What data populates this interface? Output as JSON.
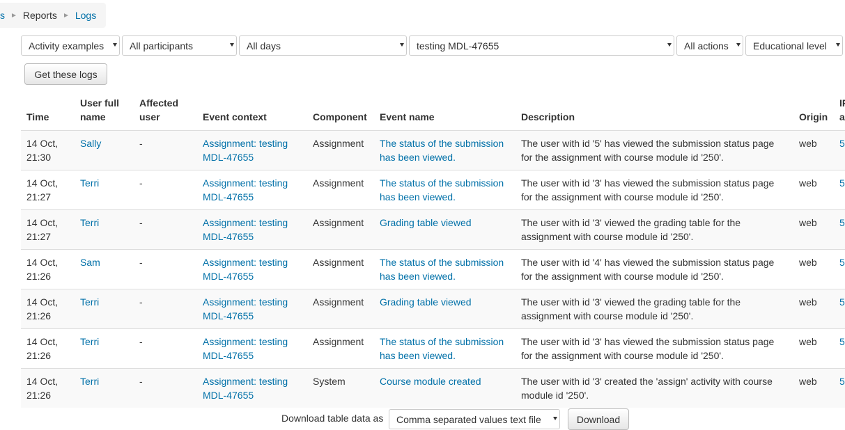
{
  "breadcrumb": {
    "prev": "s",
    "reports": "Reports",
    "current": "Logs"
  },
  "filters": {
    "course": "Activity examples",
    "participants": "All participants",
    "days": "All days",
    "activity": "testing MDL-47655",
    "actions": "All actions",
    "level": "Educational level"
  },
  "get_logs_label": "Get these logs",
  "table": {
    "headers": {
      "time": "Time",
      "user": "User full name",
      "affected": "Affected user",
      "context": "Event context",
      "component": "Component",
      "event": "Event name",
      "description": "Description",
      "origin": "Origin",
      "ip": "IP a"
    },
    "rows": [
      {
        "time": "14 Oct, 21:30",
        "user": "Sally",
        "affected": "-",
        "context": "Assignment: testing MDL-47655",
        "component": "Assignment",
        "event": "The status of the submission has been viewed.",
        "description": "The user with id '5' has viewed the submission status page for the assignment with course module id '250'.",
        "origin": "web",
        "ip": "5"
      },
      {
        "time": "14 Oct, 21:27",
        "user": "Terri",
        "affected": "-",
        "context": "Assignment: testing MDL-47655",
        "component": "Assignment",
        "event": "The status of the submission has been viewed.",
        "description": "The user with id '3' has viewed the submission status page for the assignment with course module id '250'.",
        "origin": "web",
        "ip": "5"
      },
      {
        "time": "14 Oct, 21:27",
        "user": "Terri",
        "affected": "-",
        "context": "Assignment: testing MDL-47655",
        "component": "Assignment",
        "event": "Grading table viewed",
        "description": "The user with id '3' viewed the grading table for the assignment with course module id '250'.",
        "origin": "web",
        "ip": "5"
      },
      {
        "time": "14 Oct, 21:26",
        "user": "Sam",
        "affected": "-",
        "context": "Assignment: testing MDL-47655",
        "component": "Assignment",
        "event": "The status of the submission has been viewed.",
        "description": "The user with id '4' has viewed the submission status page for the assignment with course module id '250'.",
        "origin": "web",
        "ip": "5"
      },
      {
        "time": "14 Oct, 21:26",
        "user": "Terri",
        "affected": "-",
        "context": "Assignment: testing MDL-47655",
        "component": "Assignment",
        "event": "Grading table viewed",
        "description": "The user with id '3' viewed the grading table for the assignment with course module id '250'.",
        "origin": "web",
        "ip": "5"
      },
      {
        "time": "14 Oct, 21:26",
        "user": "Terri",
        "affected": "-",
        "context": "Assignment: testing MDL-47655",
        "component": "Assignment",
        "event": "The status of the submission has been viewed.",
        "description": "The user with id '3' has viewed the submission status page for the assignment with course module id '250'.",
        "origin": "web",
        "ip": "5"
      },
      {
        "time": "14 Oct, 21:26",
        "user": "Terri",
        "affected": "-",
        "context": "Assignment: testing MDL-47655",
        "component": "System",
        "event": "Course module created",
        "description": "The user with id '3' created the 'assign' activity with course module id '250'.",
        "origin": "web",
        "ip": "5"
      }
    ]
  },
  "download": {
    "label": "Download table data as",
    "format": "Comma separated values text file",
    "button": "Download"
  }
}
